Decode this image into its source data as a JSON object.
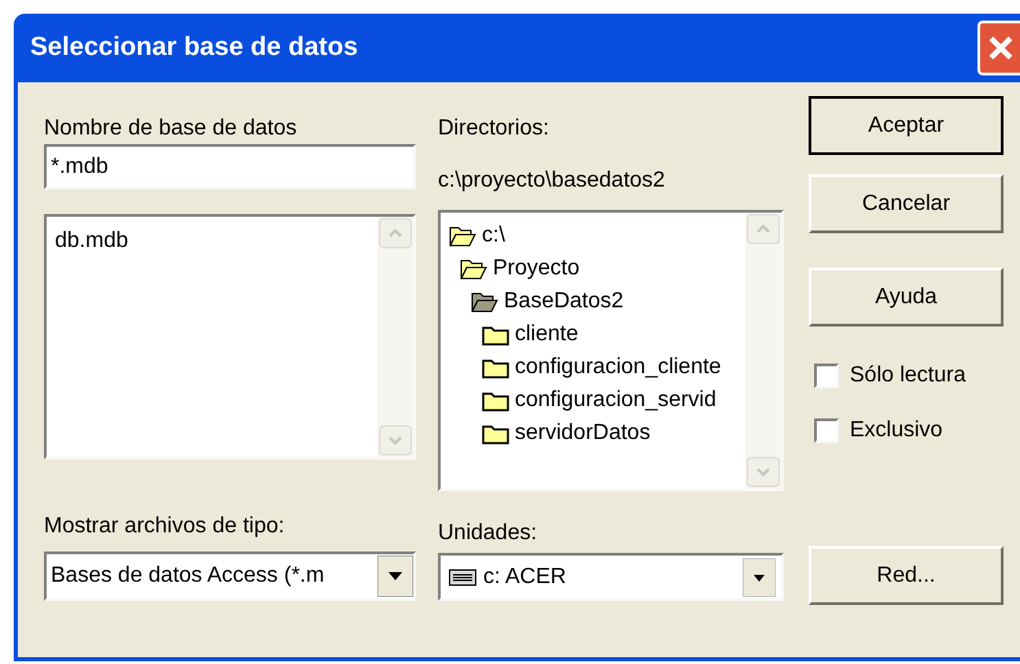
{
  "window": {
    "title": "Seleccionar base de datos"
  },
  "database_name": {
    "label": "Nombre de base de datos",
    "value": "*.mdb"
  },
  "files": [
    "db.mdb"
  ],
  "file_type": {
    "label": "Mostrar archivos de tipo:",
    "value": "Bases de datos Access (*.m"
  },
  "directories": {
    "label": "Directorios:",
    "path": "c:\\proyecto\\basedatos2",
    "tree": [
      {
        "name": "c:\\",
        "expanded": true,
        "current": false,
        "children": [
          {
            "name": "Proyecto",
            "expanded": true,
            "current": false,
            "children": [
              {
                "name": "BaseDatos2",
                "expanded": true,
                "current": true,
                "children": [
                  {
                    "name": "cliente",
                    "expanded": false,
                    "current": false
                  },
                  {
                    "name": "configuracion_cliente",
                    "expanded": false,
                    "current": false
                  },
                  {
                    "name": "configuracion_servid",
                    "expanded": false,
                    "current": false
                  },
                  {
                    "name": "servidorDatos",
                    "expanded": false,
                    "current": false
                  }
                ]
              }
            ]
          }
        ]
      }
    ]
  },
  "drives": {
    "label": "Unidades:",
    "value": "c: ACER"
  },
  "buttons": [
    {
      "label": "Aceptar",
      "default": true
    },
    {
      "label": "Cancelar",
      "default": false
    },
    {
      "label": "Ayuda",
      "default": false
    }
  ],
  "options": [
    {
      "label": "Sólo lectura",
      "checked": false
    },
    {
      "label": "Exclusivo",
      "checked": false
    }
  ],
  "network_button": {
    "label": "Red..."
  }
}
